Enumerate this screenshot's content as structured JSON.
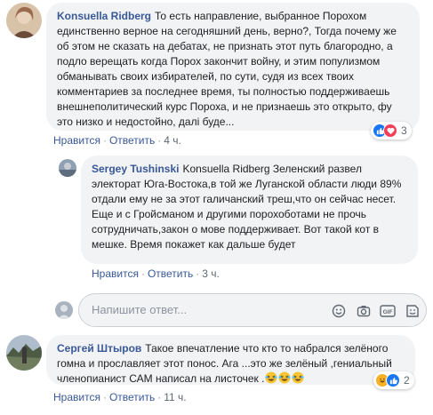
{
  "comments": [
    {
      "author": "Konsuella Ridberg",
      "text": "То есть направление, выбранное Порохом единственно верное на сегодняшний день, верно?, Тогда почему же об этом не сказать на дебатах, не признать этот путь благородно, а подло верещать когда Порох закончит войну, и этим популизмом обманывать своих избирателей, по сути, судя из всех твоих комментариев за последнее время, ты полностью поддерживаешь внешнеполитический курс Пороха, и не признаешь это открыто, фу это низко и недостойно, далі буде...",
      "like_label": "Нравится",
      "reply_label": "Ответить",
      "time": "4 ч.",
      "reaction_count": "3",
      "reactions": [
        "like-reaction",
        "love-reaction"
      ]
    },
    {
      "author": "Sergey Tushinski",
      "mention": "Konsuella Ridberg",
      "text": "Зеленский развел электорат Юга-Востока,в той же Луганской области люди 89% отдали ему не за этот галичанский треш,что он сейчас несет. Еще и с Гройсманом и другими порохоботами не прочь сотрудничать,закон о мове поддерживает. Вот такой кот в мешке. Время покажет как дальше будет",
      "like_label": "Нравится",
      "reply_label": "Ответить",
      "time": "3 ч."
    },
    {
      "author": "Сергей Штыров",
      "text": "Такое впечатление что кто то набрался зелёного гомна и прославляет этот понос. Ага ...это же зелёный ,гениальный членопианист САМ написал на листочек .",
      "emojis": [
        "laughing-emoji",
        "laughing-emoji",
        "laughing-emoji"
      ],
      "like_label": "Нравится",
      "reply_label": "Ответить",
      "time": "11 ч.",
      "reaction_count": "2",
      "reactions": [
        "laugh-reaction",
        "like-reaction"
      ]
    }
  ],
  "composer": {
    "placeholder": "Напишите ответ...",
    "icons": [
      "emoji-icon",
      "camera-icon",
      "gif-icon",
      "sticker-icon"
    ]
  },
  "colors": {
    "link": "#385898",
    "bubble": "#f2f3f5",
    "meta": "#606770",
    "like": "#1877f2",
    "love": "#f33e58",
    "haha": "#f7b125"
  }
}
